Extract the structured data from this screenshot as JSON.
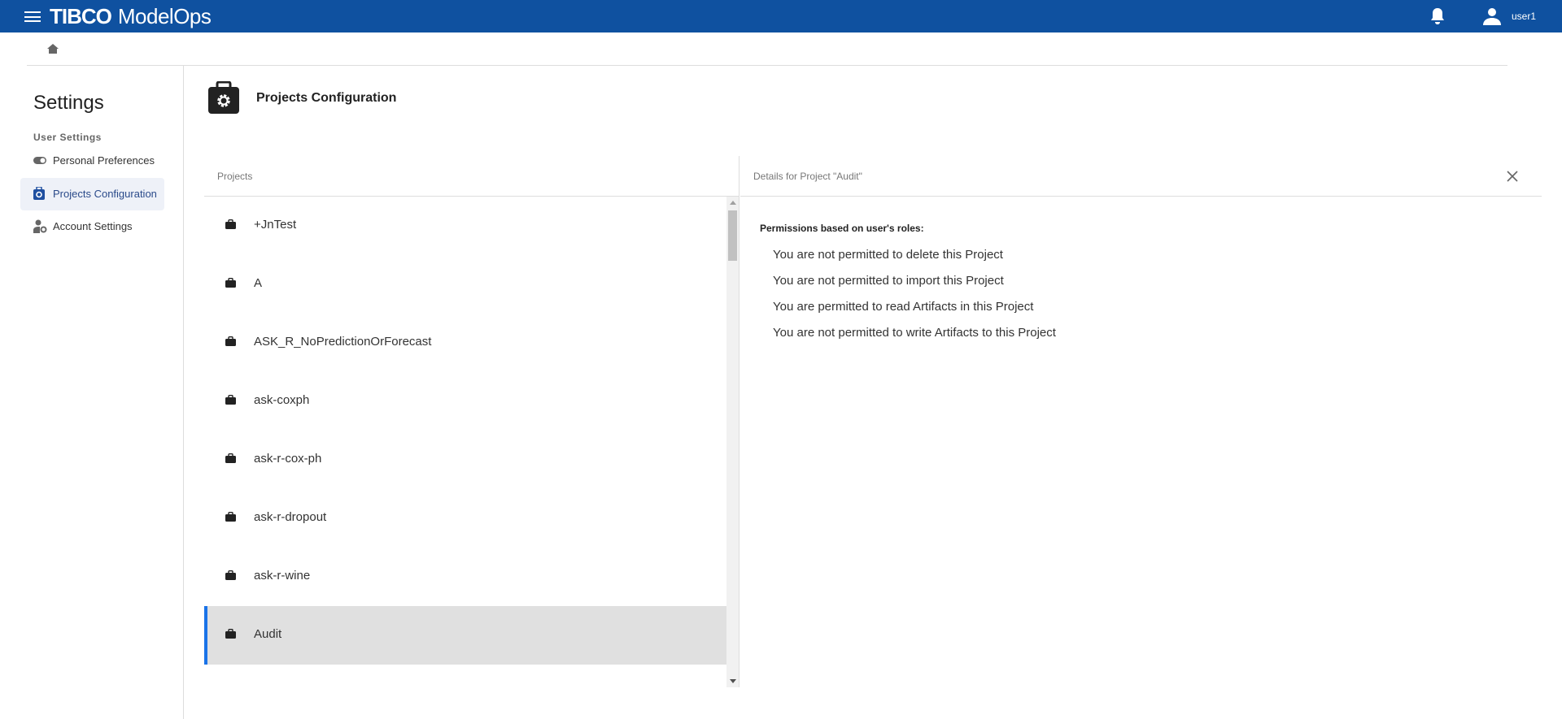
{
  "header": {
    "brand": "TIBCO",
    "product": "ModelOps",
    "username": "user1"
  },
  "sidebar": {
    "title": "Settings",
    "section": "User Settings",
    "items": [
      {
        "label": "Personal Preferences"
      },
      {
        "label": "Projects Configuration",
        "selected": true
      },
      {
        "label": "Account Settings"
      }
    ]
  },
  "main": {
    "title": "Projects Configuration"
  },
  "projects": {
    "header": "Projects",
    "items": [
      "+JnTest",
      "A",
      "ASK_R_NoPredictionOrForecast",
      "ask-coxph",
      "ask-r-cox-ph",
      "ask-r-dropout",
      "ask-r-wine",
      "Audit"
    ],
    "selected": "Audit"
  },
  "details": {
    "header": "Details for Project \"Audit\"",
    "permissions_label": "Permissions based on user's roles:",
    "permissions": [
      "You are not permitted to delete this Project",
      "You are not permitted to import this Project",
      "You are permitted to read Artifacts in this Project",
      "You are not permitted to write Artifacts to this Project"
    ]
  },
  "colors": {
    "header": "#0f51a0",
    "accent": "#1a73e8"
  }
}
